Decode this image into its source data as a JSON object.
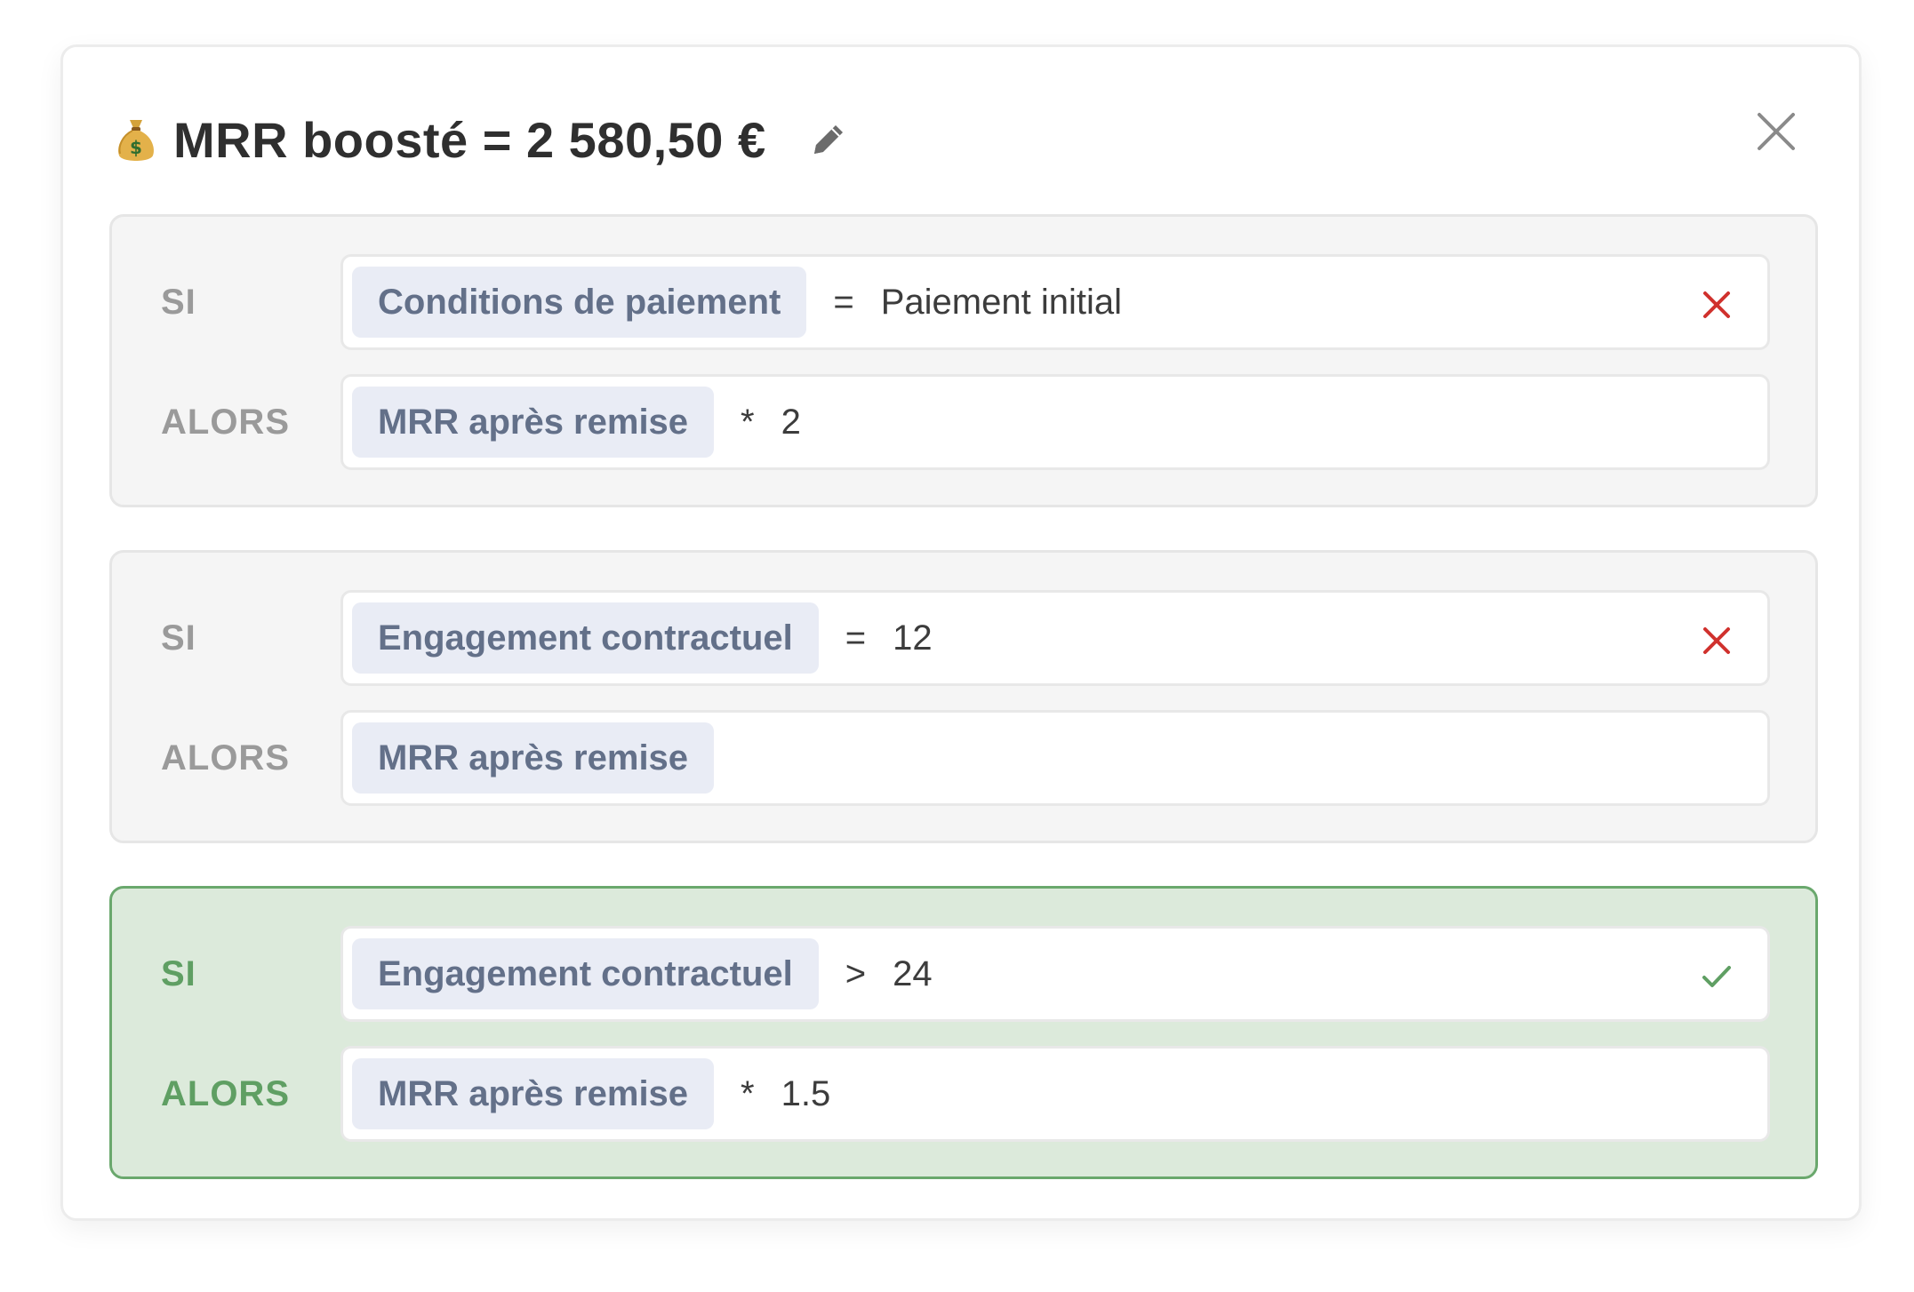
{
  "header": {
    "icon": "money-bag-icon",
    "title": "MRR boosté = 2 580,50 €",
    "edit_icon": "pencil-icon",
    "close_icon": "close-icon"
  },
  "colors": {
    "chip_bg": "#e9ecf5",
    "chip_text": "#637089",
    "fail": "#d0312d",
    "success": "#5f9f63",
    "matched_bg": "#dceadb"
  },
  "rules": [
    {
      "matched": false,
      "if_label": "SI",
      "then_label": "ALORS",
      "condition": {
        "field": "Conditions de paiement",
        "operator": "=",
        "value": "Paiement initial",
        "status": "fail"
      },
      "result": {
        "field": "MRR après remise",
        "operator": "*",
        "value": "2"
      }
    },
    {
      "matched": false,
      "if_label": "SI",
      "then_label": "ALORS",
      "condition": {
        "field": "Engagement contractuel",
        "operator": "=",
        "value": "12",
        "status": "fail"
      },
      "result": {
        "field": "MRR après remise",
        "operator": "",
        "value": ""
      }
    },
    {
      "matched": true,
      "if_label": "SI",
      "then_label": "ALORS",
      "condition": {
        "field": "Engagement contractuel",
        "operator": ">",
        "value": "24",
        "status": "success"
      },
      "result": {
        "field": "MRR après remise",
        "operator": "*",
        "value": "1.5"
      }
    }
  ]
}
